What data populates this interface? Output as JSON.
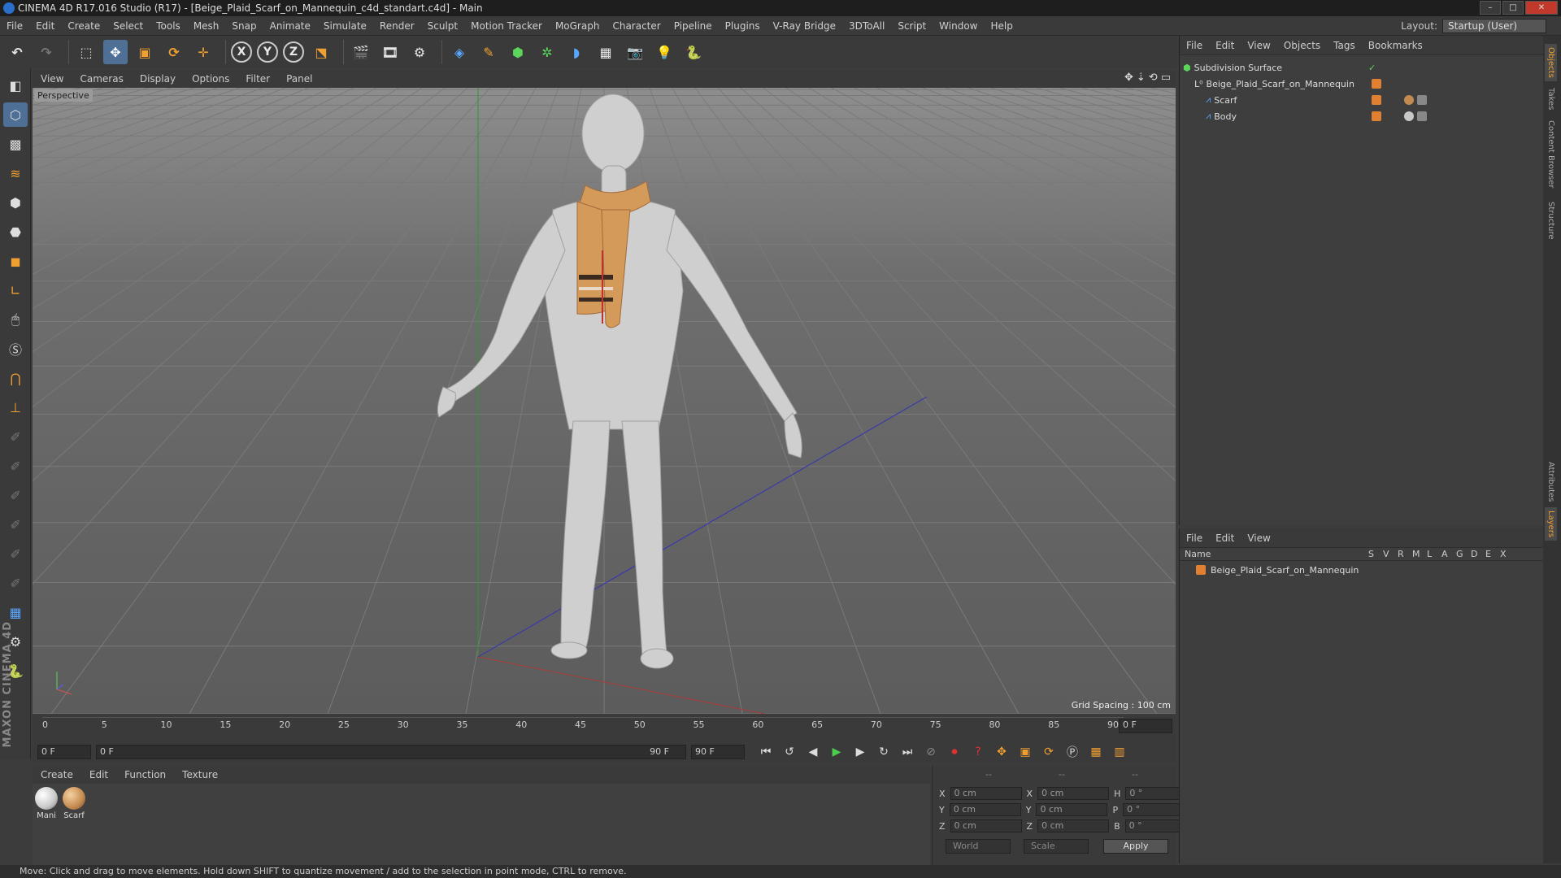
{
  "window": {
    "title": "CINEMA 4D R17.016 Studio (R17) - [Beige_Plaid_Scarf_on_Mannequin_c4d_standart.c4d] - Main",
    "min": "–",
    "max": "□",
    "close": "✕"
  },
  "menubar": {
    "items": [
      "File",
      "Edit",
      "Create",
      "Select",
      "Tools",
      "Mesh",
      "Snap",
      "Animate",
      "Simulate",
      "Render",
      "Sculpt",
      "Motion Tracker",
      "MoGraph",
      "Character",
      "Pipeline",
      "Plugins",
      "V-Ray Bridge",
      "3DToAll",
      "Script",
      "Window",
      "Help"
    ],
    "layout_label": "Layout:",
    "layout_value": "Startup (User)"
  },
  "viewport": {
    "menu": [
      "View",
      "Cameras",
      "Display",
      "Options",
      "Filter",
      "Panel"
    ],
    "label": "Perspective",
    "grid_spacing": "Grid Spacing : 100 cm"
  },
  "timeline": {
    "ticks": [
      "0",
      "5",
      "10",
      "15",
      "20",
      "25",
      "30",
      "35",
      "40",
      "45",
      "50",
      "55",
      "60",
      "65",
      "70",
      "75",
      "80",
      "85",
      "90"
    ],
    "current_frame": "0 F",
    "start_field": "0 F",
    "range_start": "0 F",
    "range_end": "90 F",
    "end_field": "90 F"
  },
  "material": {
    "menu": [
      "Create",
      "Edit",
      "Function",
      "Texture"
    ],
    "items": [
      {
        "label": "Mani",
        "color": "#c8c8c8"
      },
      {
        "label": "Scarf",
        "color": "#c48a50"
      }
    ]
  },
  "coords": {
    "headers": [
      "--",
      "--",
      "--"
    ],
    "rows": [
      {
        "a": "X",
        "av": "0 cm",
        "b": "X",
        "bv": "0 cm",
        "c": "H",
        "cv": "0 °"
      },
      {
        "a": "Y",
        "av": "0 cm",
        "b": "Y",
        "bv": "0 cm",
        "c": "P",
        "cv": "0 °"
      },
      {
        "a": "Z",
        "av": "0 cm",
        "b": "Z",
        "bv": "0 cm",
        "c": "B",
        "cv": "0 °"
      }
    ],
    "world": "World",
    "scale": "Scale",
    "apply": "Apply"
  },
  "objects": {
    "menu": [
      "File",
      "Edit",
      "View",
      "Objects",
      "Tags",
      "Bookmarks"
    ],
    "rows": [
      {
        "name": "Subdivision Surface",
        "indent": 0
      },
      {
        "name": "Beige_Plaid_Scarf_on_Mannequin",
        "indent": 1
      },
      {
        "name": "Scarf",
        "indent": 2
      },
      {
        "name": "Body",
        "indent": 2
      }
    ]
  },
  "layers": {
    "menu": [
      "File",
      "Edit",
      "View"
    ],
    "columns": [
      "Name",
      "S",
      "V",
      "R",
      "M",
      "L",
      "A",
      "G",
      "D",
      "E",
      "X"
    ],
    "row": "Beige_Plaid_Scarf_on_Mannequin"
  },
  "sidetabs": [
    "Objects",
    "Takes",
    "Content Browser",
    "Structure",
    "Attributes",
    "Layers"
  ],
  "status": "Move: Click and drag to move elements. Hold down SHIFT to quantize movement / add to the selection in point mode, CTRL to remove.",
  "brand": "MAXON CINEMA 4D",
  "colors": {
    "accent": "#f0a030",
    "active": "#4e6f96",
    "scarf": "#d49a5a",
    "body": "#cfcfcf"
  }
}
